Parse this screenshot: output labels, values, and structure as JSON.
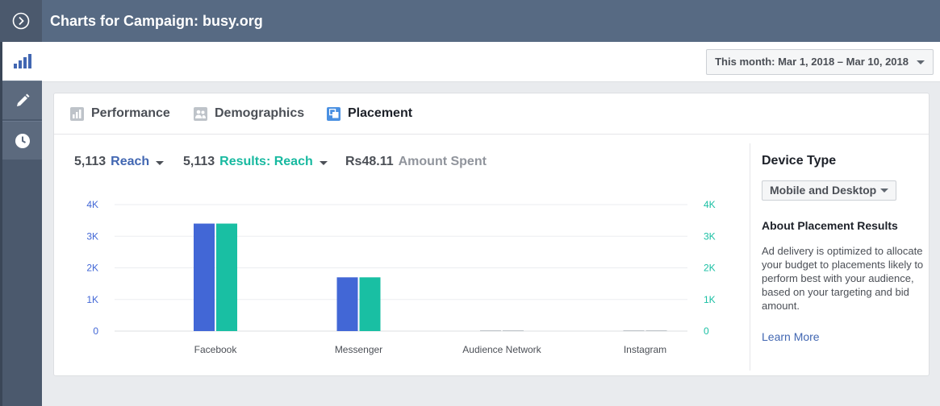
{
  "header": {
    "title": "Charts for Campaign: busy.org"
  },
  "rail": {
    "items": [
      "chart-bars-icon",
      "pencil-icon",
      "clock-icon"
    ],
    "expand_icon": "chevron-right-circle-icon"
  },
  "toolbar": {
    "date_range": "This month: Mar 1, 2018 – Mar 10, 2018"
  },
  "tabs": [
    {
      "label": "Performance",
      "icon": "bar-chart-icon"
    },
    {
      "label": "Demographics",
      "icon": "people-icon"
    },
    {
      "label": "Placement",
      "icon": "placement-icon",
      "active": true
    }
  ],
  "metrics": {
    "reach": {
      "value": "5,113",
      "label": "Reach"
    },
    "results": {
      "value": "5,113",
      "label": "Results: Reach"
    },
    "spent": {
      "value": "Rs48.11",
      "label": "Amount Spent"
    }
  },
  "colors": {
    "reach": "#4267d6",
    "results": "#19bfa3",
    "accent_blue": "#4267b2"
  },
  "chart_data": {
    "type": "bar",
    "categories": [
      "Facebook",
      "Messenger",
      "Audience Network",
      "Instagram"
    ],
    "series": [
      {
        "name": "Reach",
        "values": [
          3400,
          1700,
          0,
          0
        ]
      },
      {
        "name": "Results: Reach",
        "values": [
          3400,
          1700,
          0,
          0
        ]
      }
    ],
    "ylim": [
      0,
      4000
    ],
    "left_ticks": [
      "0",
      "1K",
      "2K",
      "3K",
      "4K"
    ],
    "right_ticks": [
      "0",
      "1K",
      "2K",
      "3K",
      "4K"
    ],
    "grid": true
  },
  "sidebar": {
    "title": "Device Type",
    "device": "Mobile and Desktop",
    "about_title": "About Placement Results",
    "about_text": "Ad delivery is optimized to allocate your budget to placements likely to perform best with your audience, based on your targeting and bid amount.",
    "learn_more": "Learn More"
  }
}
